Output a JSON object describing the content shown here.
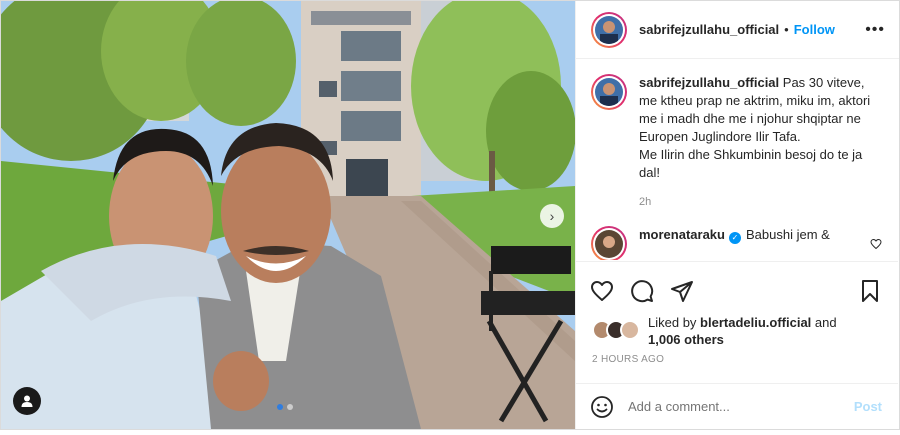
{
  "post": {
    "username": "sabrifejzullahu_official",
    "separator": "•",
    "follow_label": "Follow",
    "more_label": "•••",
    "caption": {
      "username": "sabrifejzullahu_official",
      "text": "Pas 30 viteve, me ktheu prap ne aktrim, miku im, aktori me i madh dhe me i njohur shqiptar ne Europen Juglindore Ilir Tafa.",
      "text2": "Me Ilirin dhe Shkumbinin besoj do te ja dal!",
      "time": "2h"
    },
    "comment": {
      "username": "morenataraku",
      "verified_mark": "✓",
      "text": "Babushi jem &"
    },
    "likes": {
      "prefix": "Liked by",
      "liked_by": "blertadeliu.official",
      "conjunction": "and",
      "others": "1,006 others"
    },
    "time_ago": "2 HOURS AGO",
    "add_comment": {
      "placeholder": "Add a comment...",
      "post_label": "Post"
    },
    "carousel": {
      "next_arrow": "›",
      "slide_count": 2,
      "active_slide": 1
    }
  },
  "icons": {
    "like": "heart-icon",
    "comment": "comment-icon",
    "share": "paper-plane-icon",
    "save": "bookmark-icon",
    "emoji": "smiley-icon",
    "tag": "user-tag-icon"
  },
  "colors": {
    "accent": "#0095f6",
    "post_disabled": "#b2dffc",
    "muted": "#8e8e8e",
    "text": "#262626"
  }
}
